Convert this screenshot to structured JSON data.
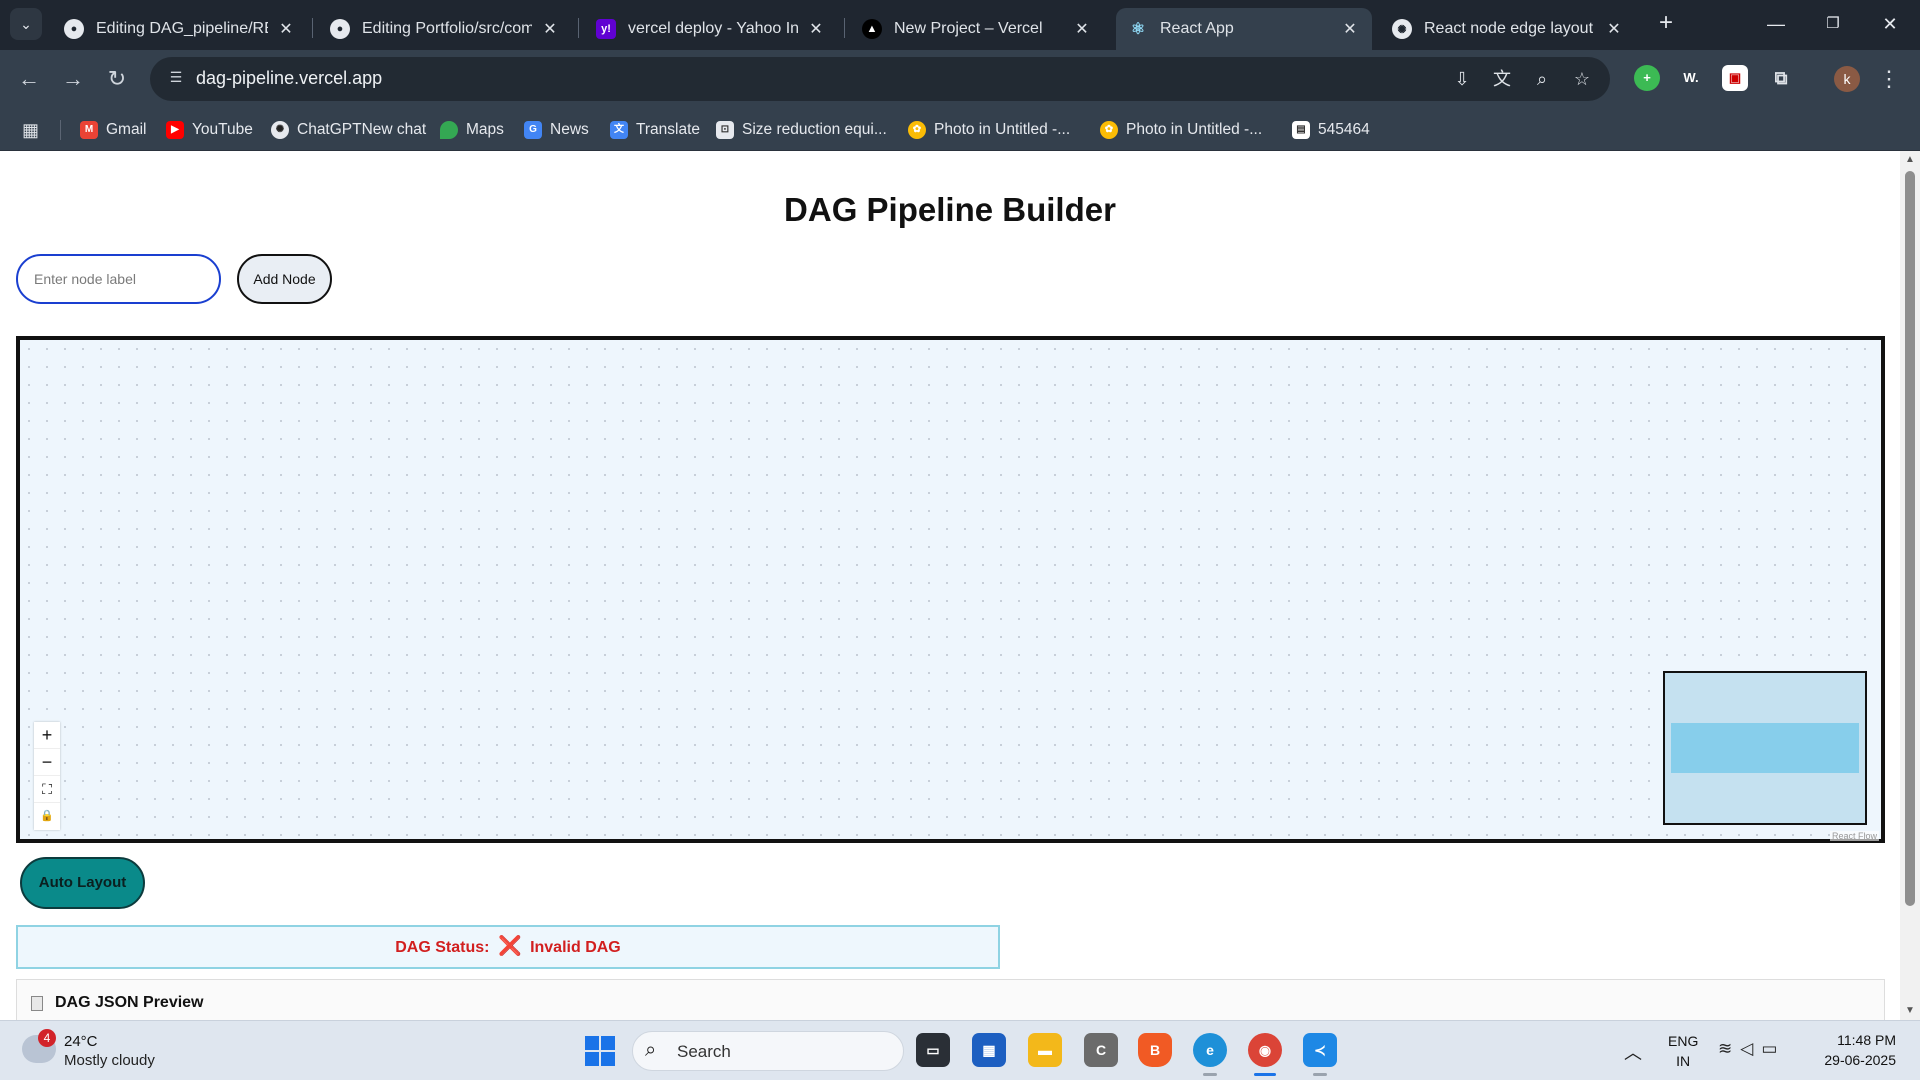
{
  "browser": {
    "tabs": [
      {
        "title": "Editing DAG_pipeline/READ",
        "icon": "github-icon"
      },
      {
        "title": "Editing Portfolio/src/comp",
        "icon": "github-icon"
      },
      {
        "title": "vercel deploy - Yahoo India",
        "icon": "yahoo-icon"
      },
      {
        "title": "New Project – Vercel",
        "icon": "vercel-icon"
      },
      {
        "title": "React App",
        "icon": "react-icon",
        "active": true
      },
      {
        "title": "React node edge layout",
        "icon": "chatgpt-icon"
      }
    ],
    "url": "dag-pipeline.vercel.app",
    "profile_initial": "k",
    "bookmarks": [
      {
        "label": "Gmail",
        "icon": "gmail-icon"
      },
      {
        "label": "YouTube",
        "icon": "youtube-icon"
      },
      {
        "label": "ChatGPTNew chat",
        "icon": "chatgpt-icon"
      },
      {
        "label": "Maps",
        "icon": "maps-icon"
      },
      {
        "label": "News",
        "icon": "news-icon"
      },
      {
        "label": "Translate",
        "icon": "translate-icon"
      },
      {
        "label": "Size reduction equi...",
        "icon": "doc-icon"
      },
      {
        "label": "Photo in Untitled -...",
        "icon": "photos-icon"
      },
      {
        "label": "Photo in Untitled -...",
        "icon": "photos-icon"
      },
      {
        "label": "545464",
        "icon": "image-icon"
      }
    ]
  },
  "app": {
    "title": "DAG Pipeline Builder",
    "node_input_placeholder": "Enter node label",
    "add_node_label": "Add Node",
    "auto_layout_label": "Auto Layout",
    "controls": [
      "+",
      "−",
      "⛶",
      "🔒"
    ],
    "attribution": "React Flow",
    "status_label": "DAG Status:",
    "status_icon": "❌",
    "status_value": "Invalid DAG",
    "json_preview_title": "DAG JSON Preview"
  },
  "taskbar": {
    "weather_badge": "4",
    "weather_temp": "24°C",
    "weather_desc": "Mostly cloudy",
    "search_label": "Search",
    "lang_1": "ENG",
    "lang_2": "IN",
    "time": "11:48 PM",
    "date": "29-06-2025"
  },
  "colors": {
    "status_error": "#d21f1f",
    "canvas_bg": "#eef6fd",
    "auto_layout_bg": "#0a8a8a",
    "input_border": "#1a3fd0"
  }
}
